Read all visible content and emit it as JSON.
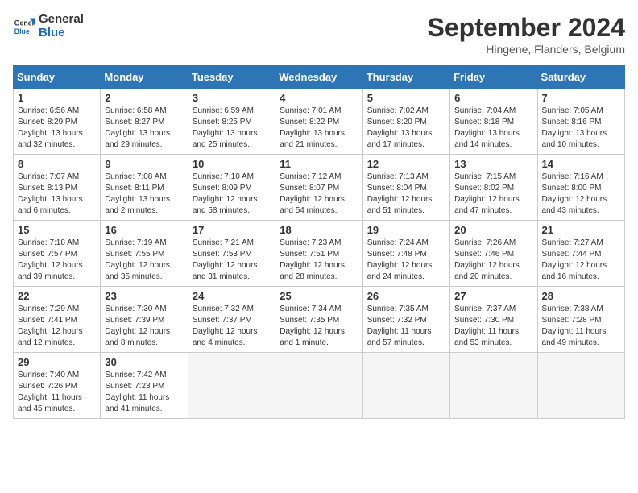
{
  "logo": {
    "line1": "General",
    "line2": "Blue"
  },
  "title": "September 2024",
  "subtitle": "Hingene, Flanders, Belgium",
  "days_of_week": [
    "Sunday",
    "Monday",
    "Tuesday",
    "Wednesday",
    "Thursday",
    "Friday",
    "Saturday"
  ],
  "weeks": [
    [
      {
        "num": "1",
        "info": "Sunrise: 6:56 AM\nSunset: 8:29 PM\nDaylight: 13 hours\nand 32 minutes."
      },
      {
        "num": "2",
        "info": "Sunrise: 6:58 AM\nSunset: 8:27 PM\nDaylight: 13 hours\nand 29 minutes."
      },
      {
        "num": "3",
        "info": "Sunrise: 6:59 AM\nSunset: 8:25 PM\nDaylight: 13 hours\nand 25 minutes."
      },
      {
        "num": "4",
        "info": "Sunrise: 7:01 AM\nSunset: 8:22 PM\nDaylight: 13 hours\nand 21 minutes."
      },
      {
        "num": "5",
        "info": "Sunrise: 7:02 AM\nSunset: 8:20 PM\nDaylight: 13 hours\nand 17 minutes."
      },
      {
        "num": "6",
        "info": "Sunrise: 7:04 AM\nSunset: 8:18 PM\nDaylight: 13 hours\nand 14 minutes."
      },
      {
        "num": "7",
        "info": "Sunrise: 7:05 AM\nSunset: 8:16 PM\nDaylight: 13 hours\nand 10 minutes."
      }
    ],
    [
      {
        "num": "8",
        "info": "Sunrise: 7:07 AM\nSunset: 8:13 PM\nDaylight: 13 hours\nand 6 minutes."
      },
      {
        "num": "9",
        "info": "Sunrise: 7:08 AM\nSunset: 8:11 PM\nDaylight: 13 hours\nand 2 minutes."
      },
      {
        "num": "10",
        "info": "Sunrise: 7:10 AM\nSunset: 8:09 PM\nDaylight: 12 hours\nand 58 minutes."
      },
      {
        "num": "11",
        "info": "Sunrise: 7:12 AM\nSunset: 8:07 PM\nDaylight: 12 hours\nand 54 minutes."
      },
      {
        "num": "12",
        "info": "Sunrise: 7:13 AM\nSunset: 8:04 PM\nDaylight: 12 hours\nand 51 minutes."
      },
      {
        "num": "13",
        "info": "Sunrise: 7:15 AM\nSunset: 8:02 PM\nDaylight: 12 hours\nand 47 minutes."
      },
      {
        "num": "14",
        "info": "Sunrise: 7:16 AM\nSunset: 8:00 PM\nDaylight: 12 hours\nand 43 minutes."
      }
    ],
    [
      {
        "num": "15",
        "info": "Sunrise: 7:18 AM\nSunset: 7:57 PM\nDaylight: 12 hours\nand 39 minutes."
      },
      {
        "num": "16",
        "info": "Sunrise: 7:19 AM\nSunset: 7:55 PM\nDaylight: 12 hours\nand 35 minutes."
      },
      {
        "num": "17",
        "info": "Sunrise: 7:21 AM\nSunset: 7:53 PM\nDaylight: 12 hours\nand 31 minutes."
      },
      {
        "num": "18",
        "info": "Sunrise: 7:23 AM\nSunset: 7:51 PM\nDaylight: 12 hours\nand 28 minutes."
      },
      {
        "num": "19",
        "info": "Sunrise: 7:24 AM\nSunset: 7:48 PM\nDaylight: 12 hours\nand 24 minutes."
      },
      {
        "num": "20",
        "info": "Sunrise: 7:26 AM\nSunset: 7:46 PM\nDaylight: 12 hours\nand 20 minutes."
      },
      {
        "num": "21",
        "info": "Sunrise: 7:27 AM\nSunset: 7:44 PM\nDaylight: 12 hours\nand 16 minutes."
      }
    ],
    [
      {
        "num": "22",
        "info": "Sunrise: 7:29 AM\nSunset: 7:41 PM\nDaylight: 12 hours\nand 12 minutes."
      },
      {
        "num": "23",
        "info": "Sunrise: 7:30 AM\nSunset: 7:39 PM\nDaylight: 12 hours\nand 8 minutes."
      },
      {
        "num": "24",
        "info": "Sunrise: 7:32 AM\nSunset: 7:37 PM\nDaylight: 12 hours\nand 4 minutes."
      },
      {
        "num": "25",
        "info": "Sunrise: 7:34 AM\nSunset: 7:35 PM\nDaylight: 12 hours\nand 1 minute."
      },
      {
        "num": "26",
        "info": "Sunrise: 7:35 AM\nSunset: 7:32 PM\nDaylight: 11 hours\nand 57 minutes."
      },
      {
        "num": "27",
        "info": "Sunrise: 7:37 AM\nSunset: 7:30 PM\nDaylight: 11 hours\nand 53 minutes."
      },
      {
        "num": "28",
        "info": "Sunrise: 7:38 AM\nSunset: 7:28 PM\nDaylight: 11 hours\nand 49 minutes."
      }
    ],
    [
      {
        "num": "29",
        "info": "Sunrise: 7:40 AM\nSunset: 7:26 PM\nDaylight: 11 hours\nand 45 minutes."
      },
      {
        "num": "30",
        "info": "Sunrise: 7:42 AM\nSunset: 7:23 PM\nDaylight: 11 hours\nand 41 minutes."
      },
      {
        "num": "",
        "info": ""
      },
      {
        "num": "",
        "info": ""
      },
      {
        "num": "",
        "info": ""
      },
      {
        "num": "",
        "info": ""
      },
      {
        "num": "",
        "info": ""
      }
    ]
  ]
}
